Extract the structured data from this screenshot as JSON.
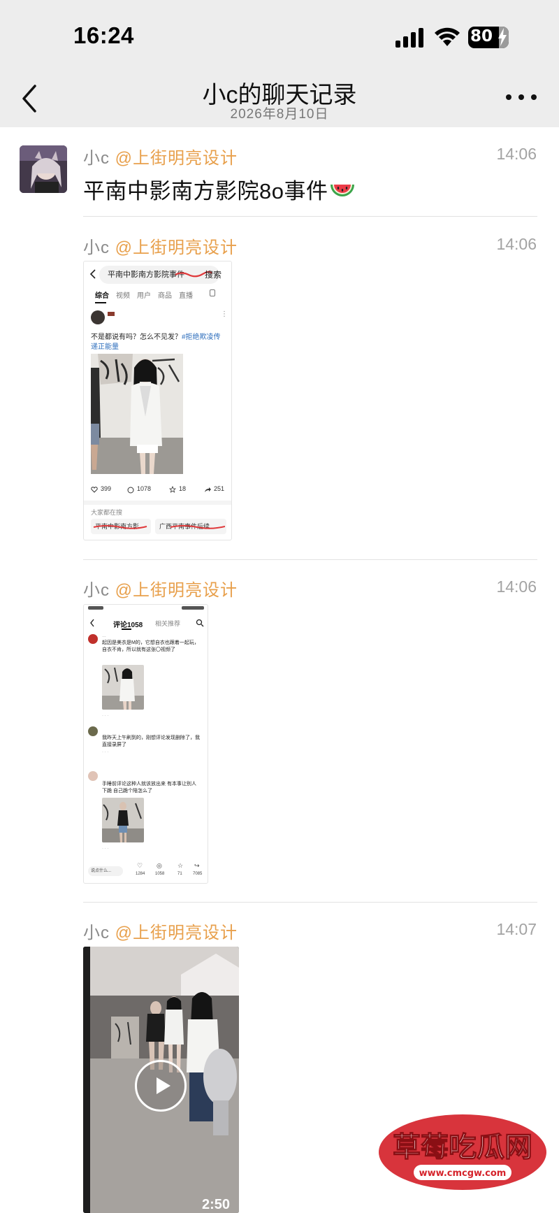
{
  "status_bar": {
    "time": "16:24",
    "battery": "80"
  },
  "nav": {
    "title": "小c的聊天记录",
    "subtitle": "2026年8月10日"
  },
  "messages": [
    {
      "nick": "小c",
      "at": "@上街明亮设计",
      "time": "14:06",
      "text": "平南中影南方影院8o事件"
    },
    {
      "nick": "小c",
      "at": "@上街明亮设计",
      "time": "14:06",
      "screenshot": {
        "search_text": "平南中影南方影院事件",
        "search_button": "搜索",
        "tabs": [
          "综合",
          "视频",
          "用户",
          "商品",
          "直播"
        ],
        "post_text": "不是都说有吗？怎么不见发？",
        "post_tag": "#拒绝欺凌传递正能量",
        "likes": "399",
        "comments": "1078",
        "stars": "18",
        "shares": "251",
        "trending_label": "大家都在搜",
        "chips": [
          "平南中影南方影",
          "广西平南事件后续"
        ]
      }
    },
    {
      "nick": "小c",
      "at": "@上街明亮设计",
      "time": "14:06",
      "screenshot2": {
        "tab_comments": "评论1058",
        "tab_related": "相关推荐",
        "comment1": "起因是美衣是M的，它想自衣也跟着一起玩，自衣不肯，所以就有这张〇视频了",
        "comment2": "我昨天上午刷到的，刚想评论发现删除了，我直接录屏了",
        "comment3": "手睡前评论这种人就该放出来 有本事让别人下跪 自己跪个陪怎么了",
        "likes": "1284",
        "comments": "1058",
        "stars": "71",
        "shares": "7085",
        "input_placeholder": "说点什么..."
      }
    },
    {
      "nick": "小c",
      "at": "@上街明亮设计",
      "time": "14:07",
      "video": {
        "duration": "2:50"
      }
    }
  ],
  "watermark": {
    "name": "草莓吃瓜网",
    "url": "www.cmcgw.com"
  },
  "colors": {
    "header_bg": "#ededed",
    "at_orange": "#e8a04c",
    "time_gray": "#a3a3a3"
  },
  "icons": [
    "back-icon",
    "more-icon",
    "signal-icon",
    "wifi-icon",
    "battery-icon",
    "watermelon-icon",
    "play-icon"
  ]
}
